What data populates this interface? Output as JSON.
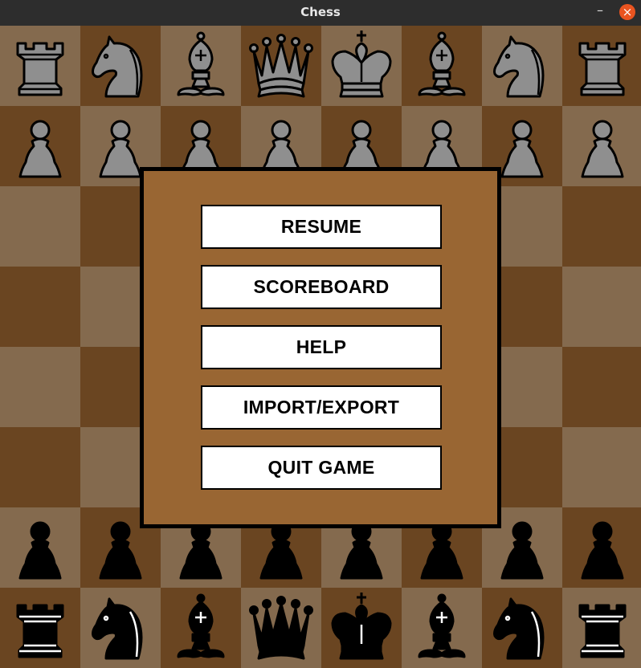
{
  "window": {
    "title": "Chess",
    "minimize_glyph": "–",
    "close_glyph": "×"
  },
  "colors": {
    "light_square": "#846a4e",
    "dark_square": "#6a4521",
    "menu_background": "#996633",
    "menu_border": "#000000",
    "button_background": "#ffffff",
    "gray_pieces": "#8f8f8f",
    "black_pieces": "#000000",
    "close_button": "#e95420"
  },
  "board": {
    "top_left_square": "light",
    "ranks": [
      [
        "gray-rook",
        "gray-knight",
        "gray-bishop",
        "gray-queen",
        "gray-king",
        "gray-bishop",
        "gray-knight",
        "gray-rook"
      ],
      [
        "gray-pawn",
        "gray-pawn",
        "gray-pawn",
        "gray-pawn",
        "gray-pawn",
        "gray-pawn",
        "gray-pawn",
        "gray-pawn"
      ],
      [
        "",
        "",
        "",
        "",
        "",
        "",
        "",
        ""
      ],
      [
        "",
        "",
        "",
        "",
        "",
        "",
        "",
        ""
      ],
      [
        "",
        "",
        "",
        "",
        "",
        "",
        "",
        ""
      ],
      [
        "",
        "",
        "",
        "",
        "",
        "",
        "",
        ""
      ],
      [
        "black-pawn",
        "black-pawn",
        "black-pawn",
        "black-pawn",
        "black-pawn",
        "black-pawn",
        "black-pawn",
        "black-pawn"
      ],
      [
        "black-rook",
        "black-knight",
        "black-bishop",
        "black-queen",
        "black-king",
        "black-bishop",
        "black-knight",
        "black-rook"
      ]
    ]
  },
  "menu": {
    "buttons": [
      {
        "id": "resume",
        "label": "RESUME"
      },
      {
        "id": "scoreboard",
        "label": "SCOREBOARD"
      },
      {
        "id": "help",
        "label": "HELP"
      },
      {
        "id": "import-export",
        "label": "IMPORT/EXPORT"
      },
      {
        "id": "quit-game",
        "label": "QUIT GAME"
      }
    ]
  }
}
